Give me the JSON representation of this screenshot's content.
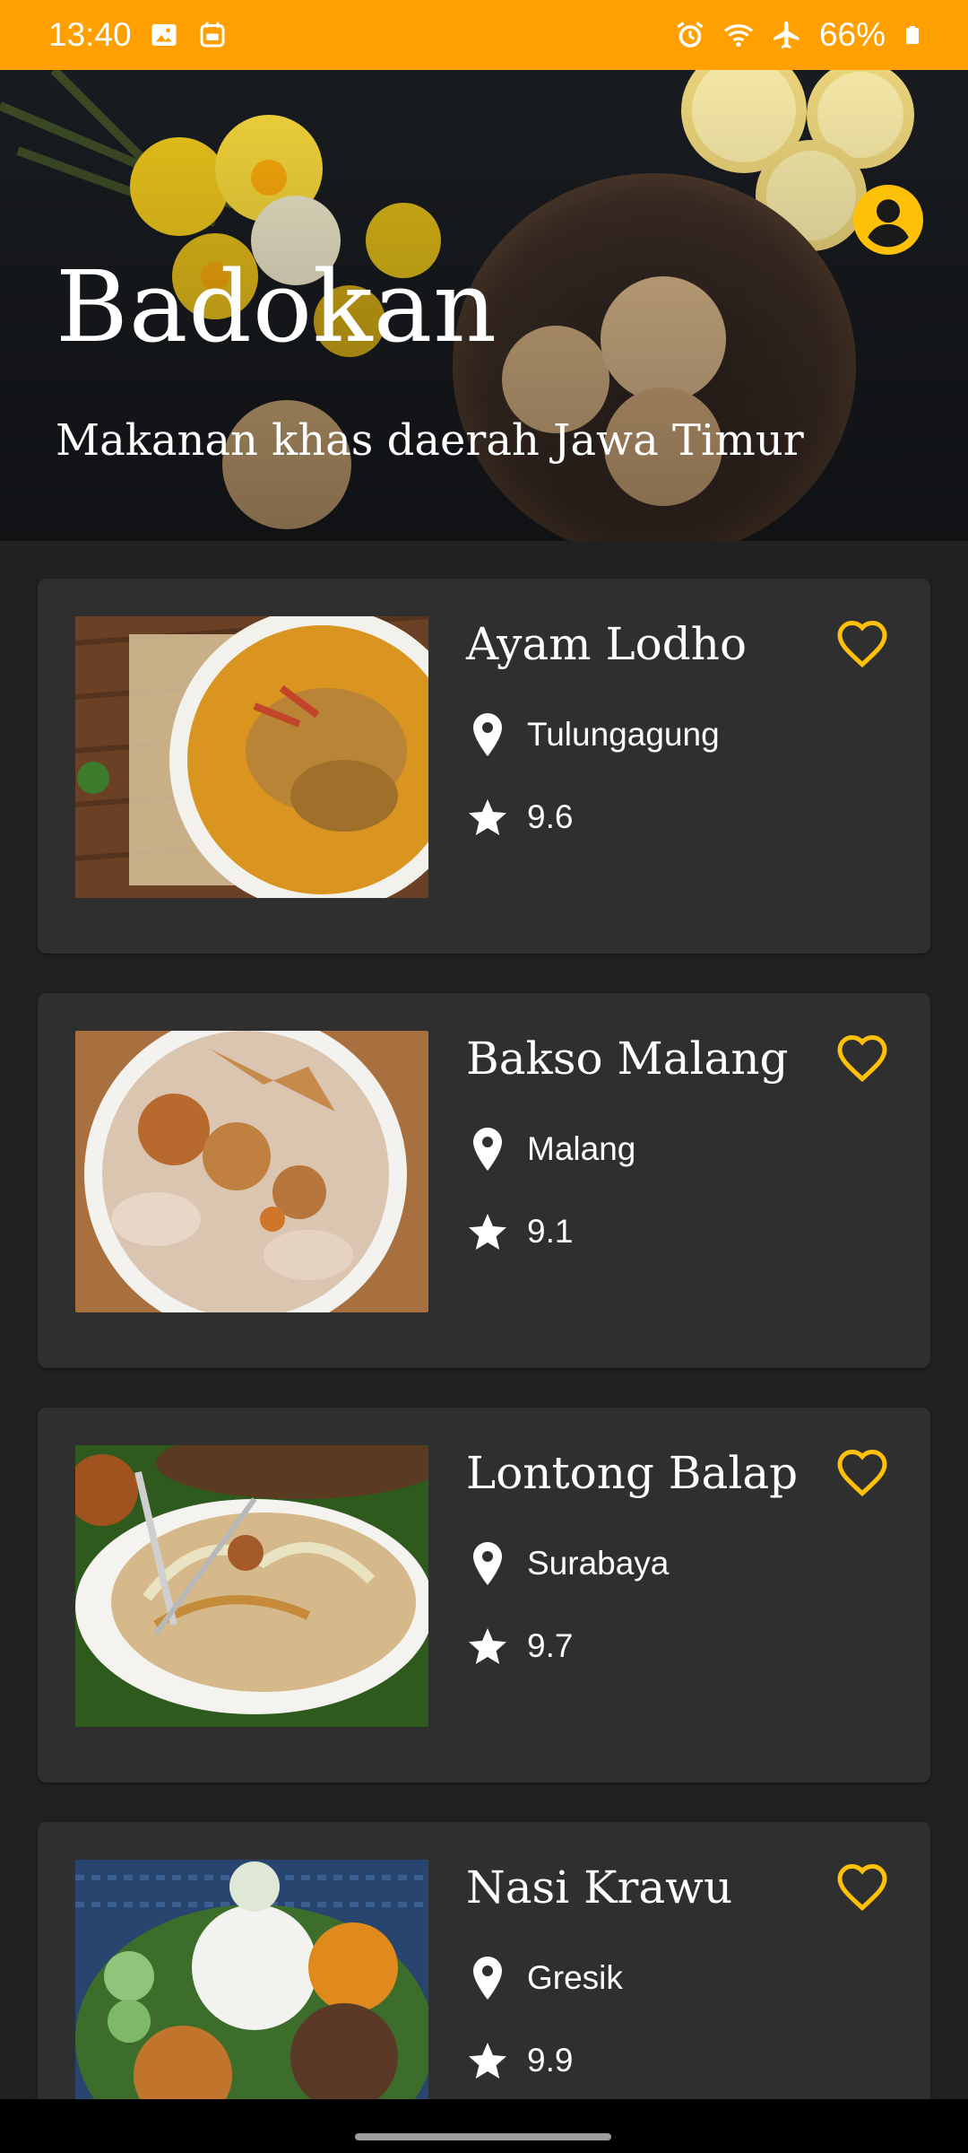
{
  "status_bar": {
    "time": "13:40",
    "battery": "66%",
    "left_icons": [
      "gallery-icon",
      "calendar-app-icon"
    ],
    "right_icons": [
      "alarm-icon",
      "wifi-icon",
      "airplane-mode-icon",
      "battery-icon"
    ]
  },
  "header": {
    "title": "Badokan",
    "subtitle": "Makanan khas daerah Jawa Timur",
    "profile_icon": "account-circle-icon"
  },
  "colors": {
    "accent": "#FFA000",
    "favorite": "#FFC107",
    "card_bg": "#2F2F2F",
    "page_bg": "#212121"
  },
  "foods": [
    {
      "name": "Ayam Lodho",
      "location": "Tulungagung",
      "rating": "9.6"
    },
    {
      "name": "Bakso Malang",
      "location": "Malang",
      "rating": "9.1"
    },
    {
      "name": "Lontong Balap",
      "location": "Surabaya",
      "rating": "9.7"
    },
    {
      "name": "Nasi Krawu",
      "location": "Gresik",
      "rating": "9.9"
    }
  ]
}
